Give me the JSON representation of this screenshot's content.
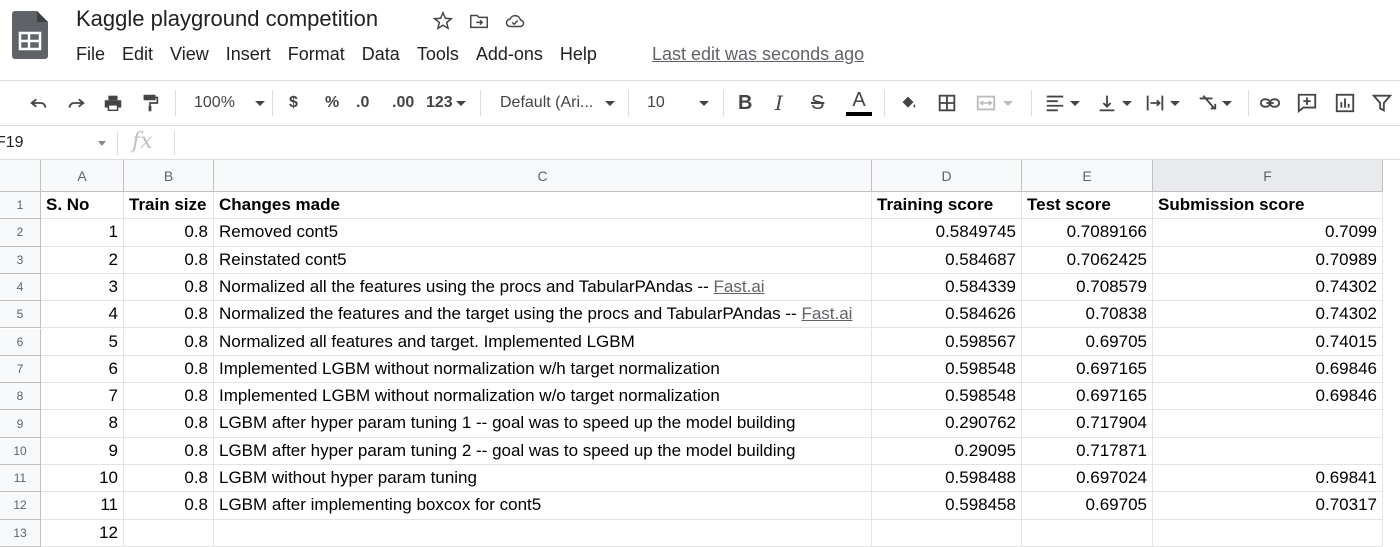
{
  "doc": {
    "title": "Kaggle playground competition",
    "last_edit": "Last edit was seconds ago"
  },
  "title_icons": [
    "star-icon",
    "move-to-folder-icon",
    "cloud-saved-icon"
  ],
  "menu": [
    "File",
    "Edit",
    "View",
    "Insert",
    "Format",
    "Data",
    "Tools",
    "Add-ons",
    "Help"
  ],
  "toolbar": {
    "zoom": "100%",
    "currency": "$",
    "percent": "%",
    "dec_decrease": ".0",
    "dec_increase": ".00",
    "more_formats": "123",
    "font": "Default (Ari...",
    "font_size": "10",
    "bold": "B",
    "italic": "I",
    "strike": "S",
    "text_color": "A"
  },
  "formula_bar": {
    "name_box": "F19",
    "fx": "fx",
    "value": ""
  },
  "columns": [
    "A",
    "B",
    "C",
    "D",
    "E",
    "F"
  ],
  "rows": [
    {
      "n": "1",
      "a": "S. No",
      "b": "Train size",
      "c": "Changes made",
      "c_link": "",
      "d": "Training score",
      "e": "Test score",
      "f": "Submission score"
    },
    {
      "n": "2",
      "a": "1",
      "b": "0.8",
      "c": "Removed cont5",
      "c_link": "",
      "d": "0.5849745",
      "e": "0.7089166",
      "f": "0.7099"
    },
    {
      "n": "3",
      "a": "2",
      "b": "0.8",
      "c": "Reinstated cont5",
      "c_link": "",
      "d": "0.584687",
      "e": "0.7062425",
      "f": "0.70989"
    },
    {
      "n": "4",
      "a": "3",
      "b": "0.8",
      "c": "Normalized all the features using the procs and TabularPAndas -- ",
      "c_link": "Fast.ai",
      "d": "0.584339",
      "e": "0.708579",
      "f": "0.74302"
    },
    {
      "n": "5",
      "a": "4",
      "b": "0.8",
      "c": "Normalized the features and the target using the procs and TabularPAndas -- ",
      "c_link": "Fast.ai",
      "d": "0.584626",
      "e": "0.70838",
      "f": "0.74302"
    },
    {
      "n": "6",
      "a": "5",
      "b": "0.8",
      "c": "Normalized all features and target. Implemented LGBM",
      "c_link": "",
      "d": "0.598567",
      "e": "0.69705",
      "f": "0.74015"
    },
    {
      "n": "7",
      "a": "6",
      "b": "0.8",
      "c": "Implemented LGBM without normalization w/h target normalization",
      "c_link": "",
      "d": "0.598548",
      "e": "0.697165",
      "f": "0.69846"
    },
    {
      "n": "8",
      "a": "7",
      "b": "0.8",
      "c": "Implemented LGBM without normalization w/o target normalization",
      "c_link": "",
      "d": "0.598548",
      "e": "0.697165",
      "f": "0.69846"
    },
    {
      "n": "9",
      "a": "8",
      "b": "0.8",
      "c": "LGBM after hyper param tuning 1 -- goal was to speed up the model building",
      "c_link": "",
      "d": "0.290762",
      "e": "0.717904",
      "f": ""
    },
    {
      "n": "10",
      "a": "9",
      "b": "0.8",
      "c": "LGBM after hyper param tuning 2 -- goal was to speed up the model building",
      "c_link": "",
      "d": "0.29095",
      "e": "0.717871",
      "f": ""
    },
    {
      "n": "11",
      "a": "10",
      "b": "0.8",
      "c": "LGBM without hyper param tuning",
      "c_link": "",
      "d": "0.598488",
      "e": "0.697024",
      "f": "0.69841"
    },
    {
      "n": "12",
      "a": "11",
      "b": "0.8",
      "c": "LGBM after implementing boxcox for cont5",
      "c_link": "",
      "d": "0.598458",
      "e": "0.69705",
      "f": "0.70317"
    },
    {
      "n": "13",
      "a": "12",
      "b": "",
      "c": "",
      "c_link": "",
      "d": "",
      "e": "",
      "f": ""
    }
  ],
  "colors": {
    "selected_col_header": "#e8eaed",
    "logo_green": "#5f6368"
  }
}
